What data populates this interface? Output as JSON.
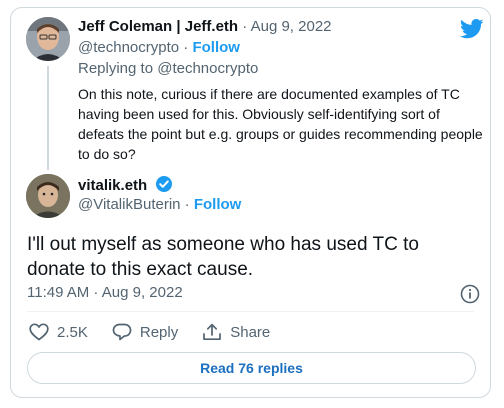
{
  "reply_tweet": {
    "author_name": "Jeff Coleman | Jeff.eth",
    "separator": " · ",
    "date": "Aug 9, 2022",
    "handle": "@technocrypto",
    "follow_sep": " · ",
    "follow_label": "Follow",
    "replying_prefix": "Replying to ",
    "replying_handle": "@technocrypto",
    "text": "On this note, curious if there are documented examples of TC having been used for this. Obviously self-identifying sort of defeats the point but e.g. groups or guides recommending people to do so?"
  },
  "main_tweet": {
    "author_name": "vitalik.eth",
    "handle": "@VitalikButerin",
    "follow_sep": " · ",
    "follow_label": "Follow",
    "text": "I'll out myself as someone who has used TC to donate to this exact cause.",
    "timestamp": "11:49 AM · Aug 9, 2022"
  },
  "actions": {
    "like_count": "2.5K",
    "reply_label": "Reply",
    "share_label": "Share"
  },
  "read_replies_label": "Read 76 replies",
  "colors": {
    "accent": "#1d9bf0",
    "border": "#cfd9de",
    "muted": "#536471"
  },
  "icons": [
    "twitter-logo-icon",
    "verified-badge-icon",
    "info-icon",
    "heart-icon",
    "reply-bubble-icon",
    "share-icon"
  ]
}
